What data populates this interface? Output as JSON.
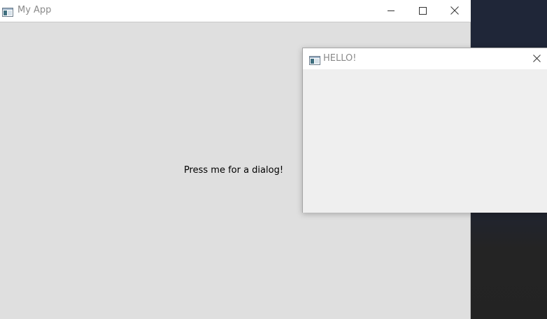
{
  "main_window": {
    "title": "My App",
    "icon": "app-window-icon",
    "controls": [
      "minimize-icon",
      "maximize-icon",
      "close-icon"
    ],
    "button_label": "Press me for a dialog!"
  },
  "dialog_window": {
    "title": "HELLO!",
    "icon": "app-window-icon",
    "controls": [
      "close-icon"
    ]
  },
  "colors": {
    "titlebar_bg": "#ffffff",
    "main_client_bg": "#dfdfdf",
    "dialog_client_bg": "#efefef",
    "title_text": "#8a8a8a",
    "desktop_bg": "#1f2638"
  }
}
